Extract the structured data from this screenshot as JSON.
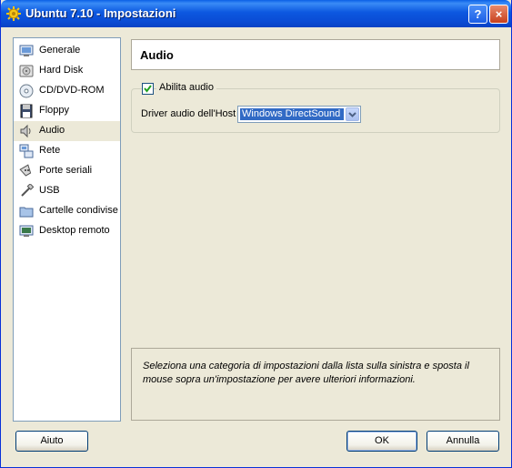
{
  "window": {
    "title": "Ubuntu 7.10 - Impostazioni"
  },
  "titlebar_buttons": {
    "help": "?",
    "close": "×"
  },
  "sidebar": {
    "items": [
      {
        "label": "Generale",
        "icon": "general-icon"
      },
      {
        "label": "Hard Disk",
        "icon": "hard-disk-icon"
      },
      {
        "label": "CD/DVD-ROM",
        "icon": "cd-dvd-icon"
      },
      {
        "label": "Floppy",
        "icon": "floppy-icon"
      },
      {
        "label": "Audio",
        "icon": "speaker-icon",
        "selected": true
      },
      {
        "label": "Rete",
        "icon": "network-icon"
      },
      {
        "label": "Porte seriali",
        "icon": "serial-port-icon"
      },
      {
        "label": "USB",
        "icon": "usb-icon"
      },
      {
        "label": "Cartelle condivise",
        "icon": "folder-icon"
      },
      {
        "label": "Desktop remoto",
        "icon": "remote-desktop-icon"
      }
    ]
  },
  "main": {
    "section_title": "Audio",
    "enable_audio": {
      "label": "Abilita audio",
      "checked": true
    },
    "host_driver": {
      "label": "Driver audio dell'Host",
      "value": "Windows DirectSound"
    },
    "info_text": "Seleziona una categoria di impostazioni dalla lista sulla sinistra e sposta il mouse sopra un'impostazione per avere ulteriori informazioni."
  },
  "buttons": {
    "help": "Aiuto",
    "ok": "OK",
    "cancel": "Annulla"
  },
  "colors": {
    "selection": "#316ac5",
    "titlebar": "#0a5fe6",
    "window_bg": "#ece9d8"
  }
}
